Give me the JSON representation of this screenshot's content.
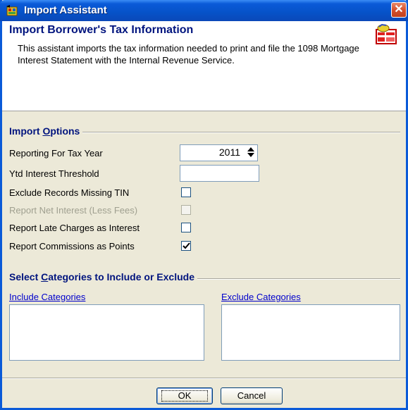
{
  "window": {
    "title": "Import Assistant",
    "close_glyph": "✕",
    "title_icon": "import-wizard-icon"
  },
  "header": {
    "title": "Import Borrower's Tax Information",
    "description": "This assistant imports the tax information needed to print and file the 1098 Mortgage Interest Statement with the Internal Revenue Service.",
    "icon": "tax-form-icon"
  },
  "import_options": {
    "section_prefix": "Import ",
    "section_accel": "O",
    "section_suffix": "ptions",
    "tax_year_label": "Reporting For Tax Year",
    "tax_year_value": "2011",
    "ytd_threshold_label": "Ytd Interest Threshold",
    "ytd_threshold_value": "",
    "exclude_missing_tin_label": "Exclude Records Missing TIN",
    "exclude_missing_tin_checked": false,
    "report_net_interest_label": "Report Net Interest (Less Fees)",
    "report_net_interest_checked": false,
    "report_late_charges_label": "Report Late Charges as Interest",
    "report_late_charges_checked": false,
    "report_commissions_label": "Report Commissions as Points",
    "report_commissions_checked": true
  },
  "categories": {
    "section_prefix": "Select ",
    "section_accel": "C",
    "section_suffix": "ategories to Include or Exclude",
    "include_label": "Include Categories",
    "exclude_label": "Exclude Categories"
  },
  "buttons": {
    "ok_label": "OK",
    "cancel_label": "Cancel"
  },
  "colors": {
    "titlebar": "#0a5ad8",
    "section_heading": "#00147e",
    "link": "#0000cc",
    "dialog_bg": "#ece9d8"
  }
}
